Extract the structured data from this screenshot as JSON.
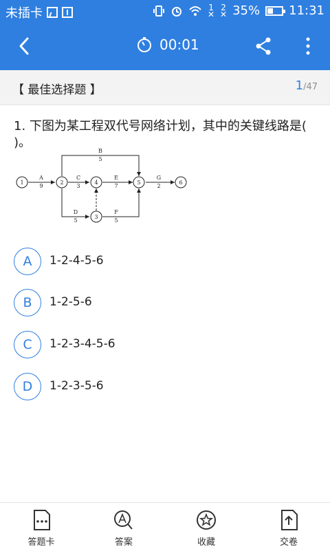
{
  "status": {
    "carrier": "未插卡",
    "sig1": "1",
    "sig2": "2",
    "battery": "35%",
    "time": "11:31"
  },
  "header": {
    "timer": "00:01"
  },
  "section": {
    "label": "【 最佳选择题 】",
    "current": "1",
    "total": "/47"
  },
  "question": {
    "text": "1. 下图为某工程双代号网络计划，其中的关键线路是(   )。"
  },
  "diagram": {
    "nodes": [
      "1",
      "2",
      "3",
      "4",
      "5",
      "6"
    ],
    "edges": [
      {
        "name": "A",
        "duration": "9"
      },
      {
        "name": "B",
        "duration": "5"
      },
      {
        "name": "C",
        "duration": "3"
      },
      {
        "name": "D",
        "duration": "5"
      },
      {
        "name": "E",
        "duration": "7"
      },
      {
        "name": "F",
        "duration": "5"
      },
      {
        "name": "G",
        "duration": "2"
      }
    ]
  },
  "options": [
    {
      "letter": "A",
      "text": "1-2-4-5-6"
    },
    {
      "letter": "B",
      "text": "1-2-5-6"
    },
    {
      "letter": "C",
      "text": "1-2-3-4-5-6"
    },
    {
      "letter": "D",
      "text": "1-2-3-5-6"
    }
  ],
  "bottom_tabs": [
    {
      "label": "答题卡",
      "icon": "answer-card-icon"
    },
    {
      "label": "答案",
      "icon": "answer-search-icon"
    },
    {
      "label": "收藏",
      "icon": "star-icon"
    },
    {
      "label": "交卷",
      "icon": "submit-icon"
    }
  ],
  "colors": {
    "accent": "#2f7fe0",
    "section_bg": "#f3f3f3"
  }
}
